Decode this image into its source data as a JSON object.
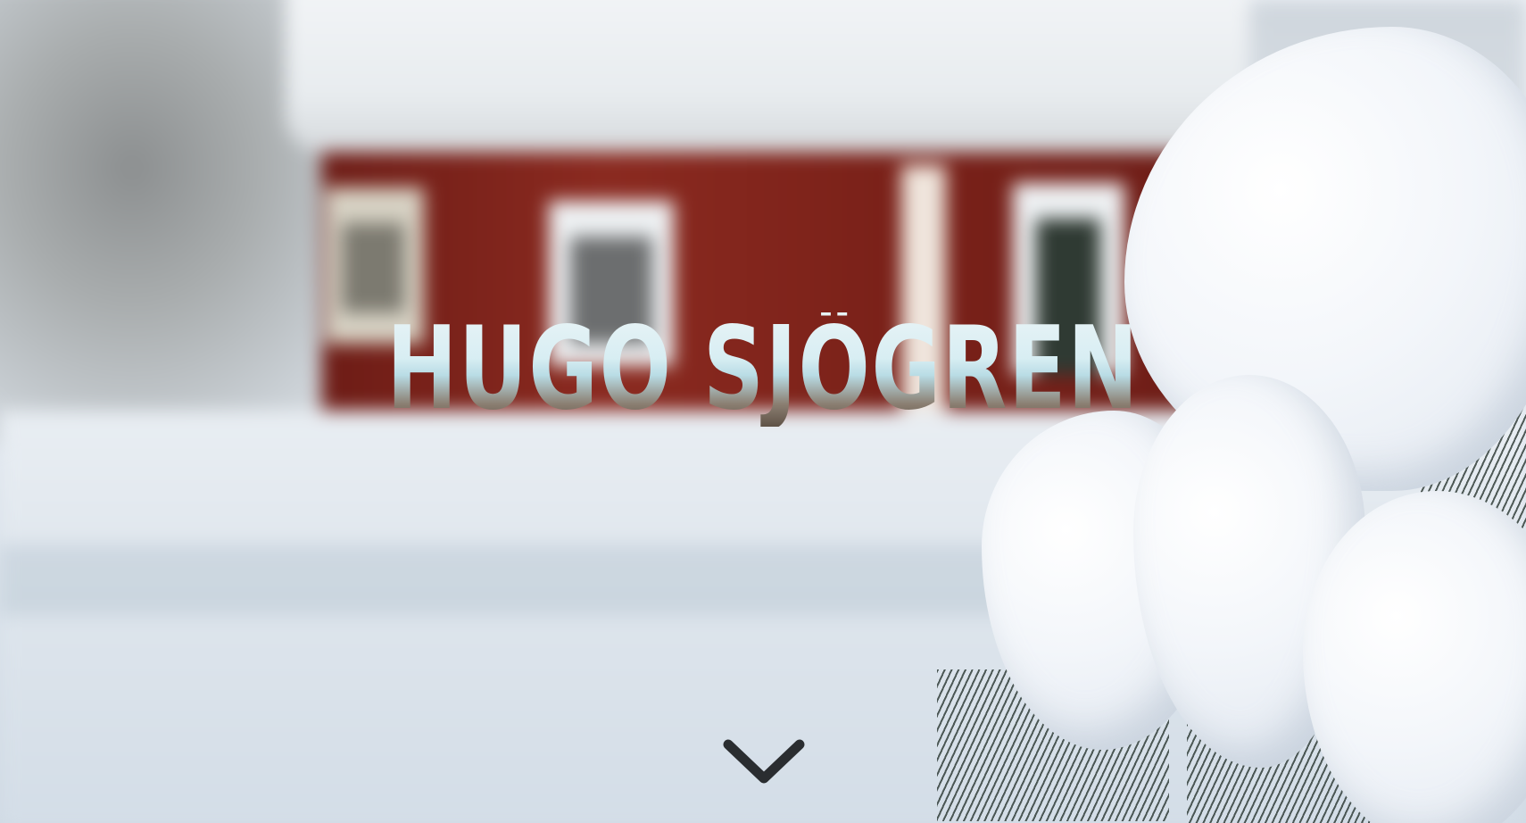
{
  "hero": {
    "title": "HUGO SJÖGREN",
    "scroll_icon": "chevron-down-icon"
  },
  "colors": {
    "chevron": "#2a2d30"
  }
}
